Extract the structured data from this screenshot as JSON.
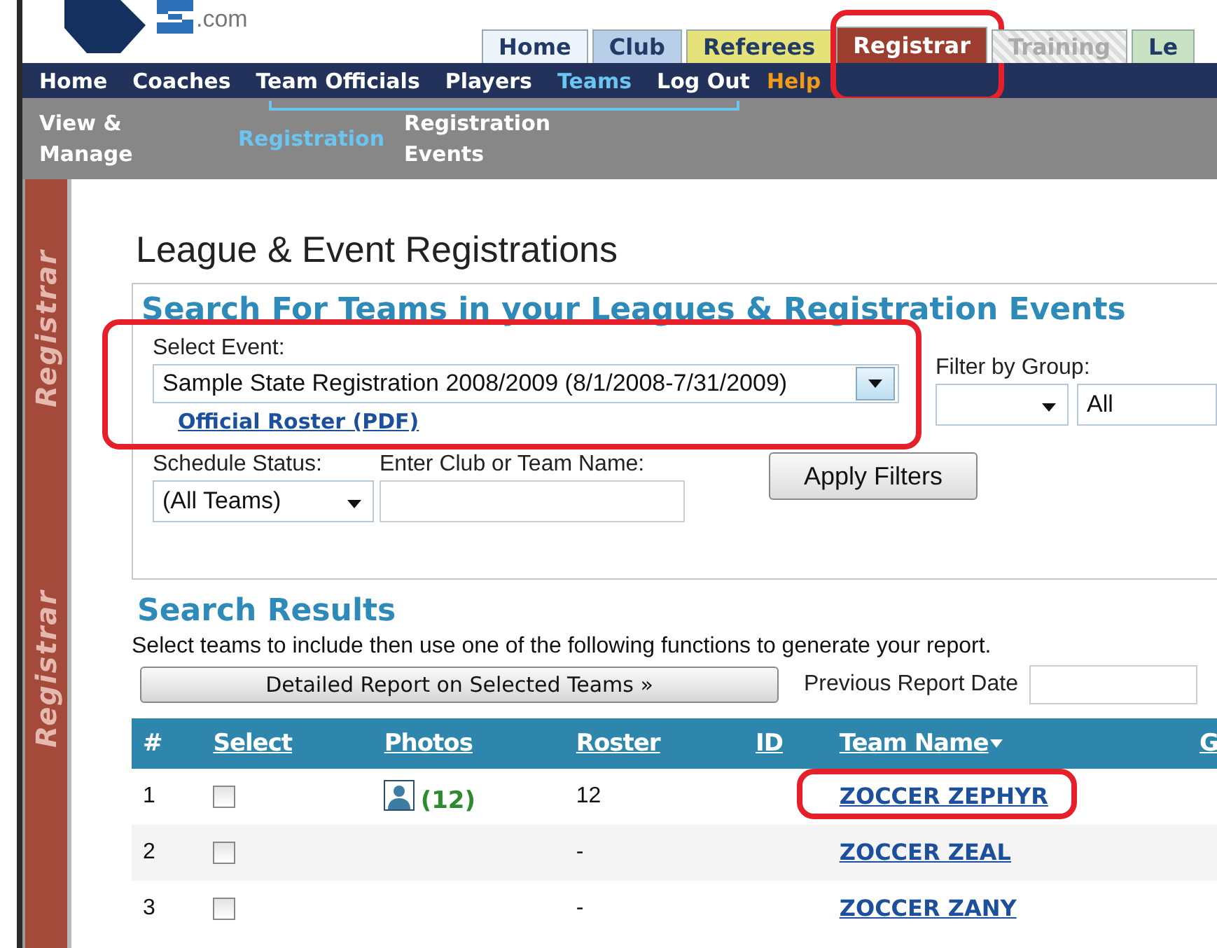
{
  "logo": {
    "text": ".com"
  },
  "tabs": [
    {
      "label": "Home",
      "selected": false,
      "disabled": false,
      "highlighted": false,
      "color": "#eef4fb"
    },
    {
      "label": "Club",
      "selected": false,
      "disabled": false,
      "highlighted": false,
      "color": "#b9cfe9"
    },
    {
      "label": "Referees",
      "selected": false,
      "disabled": false,
      "highlighted": false,
      "color": "#e6e27a"
    },
    {
      "label": "Registrar",
      "selected": true,
      "disabled": false,
      "highlighted": true,
      "color": "#9c3e2f"
    },
    {
      "label": "Training",
      "selected": false,
      "disabled": true,
      "highlighted": false,
      "color": "#dcdcdc"
    },
    {
      "label": "Le",
      "selected": false,
      "disabled": false,
      "highlighted": false,
      "color": "#c9e2c4"
    }
  ],
  "nav": [
    {
      "label": "Home",
      "selected": false,
      "kind": "link"
    },
    {
      "label": "Coaches",
      "selected": false,
      "kind": "link"
    },
    {
      "label": "Team Officials",
      "selected": false,
      "kind": "link"
    },
    {
      "label": "Players",
      "selected": false,
      "kind": "link"
    },
    {
      "label": "Teams",
      "selected": true,
      "kind": "link"
    },
    {
      "label": "Log Out",
      "selected": false,
      "kind": "link"
    },
    {
      "label": "Help",
      "selected": false,
      "kind": "help"
    }
  ],
  "subnav": [
    {
      "label": "View & Manage",
      "selected": false
    },
    {
      "label": "Registration",
      "selected": true
    },
    {
      "label": "Registration Events",
      "selected": false
    }
  ],
  "sidebar": {
    "labels": [
      "Registrar",
      "Registrar"
    ]
  },
  "page_title": "League & Event Registrations",
  "search": {
    "heading": "Search For Teams in your Leagues & Registration Events",
    "event_label": "Select Event:",
    "event_value": "Sample State Registration 2008/2009 (8/1/2008-7/31/2009)",
    "event_highlighted": true,
    "roster_link": "Official Roster (PDF)",
    "group_label": "Filter by Group:",
    "group_value": "All",
    "status_label": "Schedule Status:",
    "status_value": "(All Teams)",
    "name_label": "Enter Club or Team Name:",
    "apply_button": "Apply Filters"
  },
  "results": {
    "heading": "Search Results",
    "instructions": "Select teams to include then use one of the following functions to generate your report.",
    "report_button": "Detailed Report on Selected Teams »",
    "previous_date_label": "Previous Report Date",
    "columns": [
      {
        "label": "#",
        "link": false,
        "sorted": false
      },
      {
        "label": "Select",
        "link": true,
        "sorted": false
      },
      {
        "label": "Photos",
        "link": true,
        "sorted": false
      },
      {
        "label": "Roster",
        "link": true,
        "sorted": false
      },
      {
        "label": "ID",
        "link": true,
        "sorted": false
      },
      {
        "label": "Team Name",
        "link": true,
        "sorted": true
      },
      {
        "label": "G",
        "link": true,
        "sorted": false
      }
    ],
    "rows": [
      {
        "number": "1",
        "checked": false,
        "photo_count": "(12)",
        "roster": "12",
        "team": "ZOCCER ZEPHYR",
        "highlighted": true
      },
      {
        "number": "2",
        "checked": false,
        "roster": "-",
        "team": "ZOCCER ZEAL",
        "highlighted": false
      },
      {
        "number": "3",
        "checked": false,
        "roster": "-",
        "team": "ZOCCER ZANY",
        "highlighted": false
      }
    ]
  }
}
